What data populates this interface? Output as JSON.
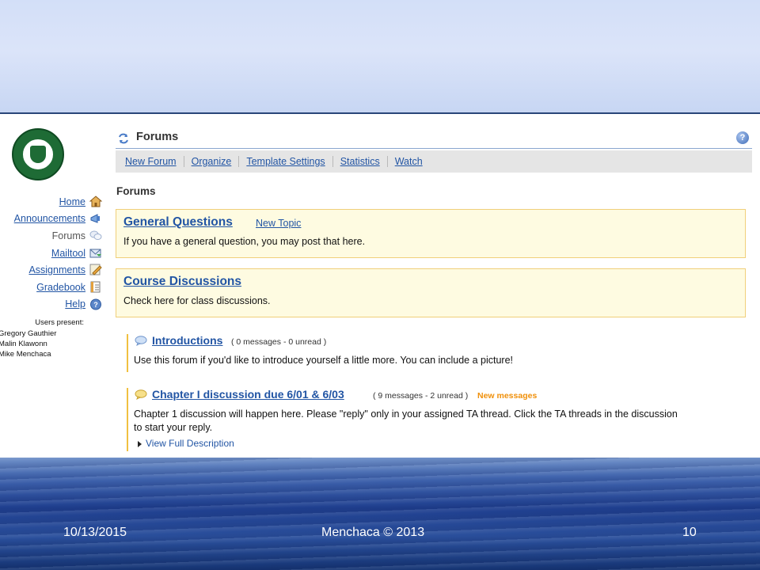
{
  "nav": {
    "items": [
      {
        "label": "Home",
        "icon": "home-icon",
        "current": false
      },
      {
        "label": "Announcements",
        "icon": "megaphone-icon",
        "current": false
      },
      {
        "label": "Forums",
        "icon": "speech-bubbles-icon",
        "current": true
      },
      {
        "label": "Mailtool",
        "icon": "mail-icon",
        "current": false
      },
      {
        "label": "Assignments",
        "icon": "pencil-note-icon",
        "current": false
      },
      {
        "label": "Gradebook",
        "icon": "gradebook-icon",
        "current": false
      },
      {
        "label": "Help",
        "icon": "help-icon",
        "current": false
      }
    ],
    "users_header": "Users present:",
    "users": [
      "Gregory Gauthier",
      "Malin Klawonn",
      "Mike Menchaca"
    ]
  },
  "header": {
    "title": "Forums",
    "help_glyph": "?"
  },
  "toolbar": {
    "items": [
      "New Forum",
      "Organize",
      "Template Settings",
      "Statistics",
      "Watch"
    ]
  },
  "section_title": "Forums",
  "categories": [
    {
      "name": "General Questions",
      "new_topic": "New Topic",
      "desc": "If you have a general question, you may post that here."
    },
    {
      "name": "Course Discussions",
      "desc": "Check here for class discussions."
    }
  ],
  "forums": [
    {
      "name": "Introductions",
      "count": "( 0 messages - 0 unread )",
      "desc": "Use this forum if you'd like to introduce yourself a little more. You can include a picture!"
    },
    {
      "name": "Chapter I discussion due 6/01 & 6/03",
      "count": "( 9 messages - 2 unread )",
      "new": "New messages",
      "desc_line1": "Chapter 1 discussion will happen here. Please \"reply\" only in your assigned TA thread. Click the TA threads in the discussion",
      "desc_line2": "to start your reply.",
      "more": "View Full Description"
    }
  ],
  "footer": {
    "date": "10/13/2015",
    "author": "Menchaca © 2013",
    "page": "10"
  },
  "colors": {
    "link": "#2255a4",
    "category_bg": "#fefbe1",
    "category_border": "#f0cf7a",
    "new_messages": "#f0900a"
  }
}
